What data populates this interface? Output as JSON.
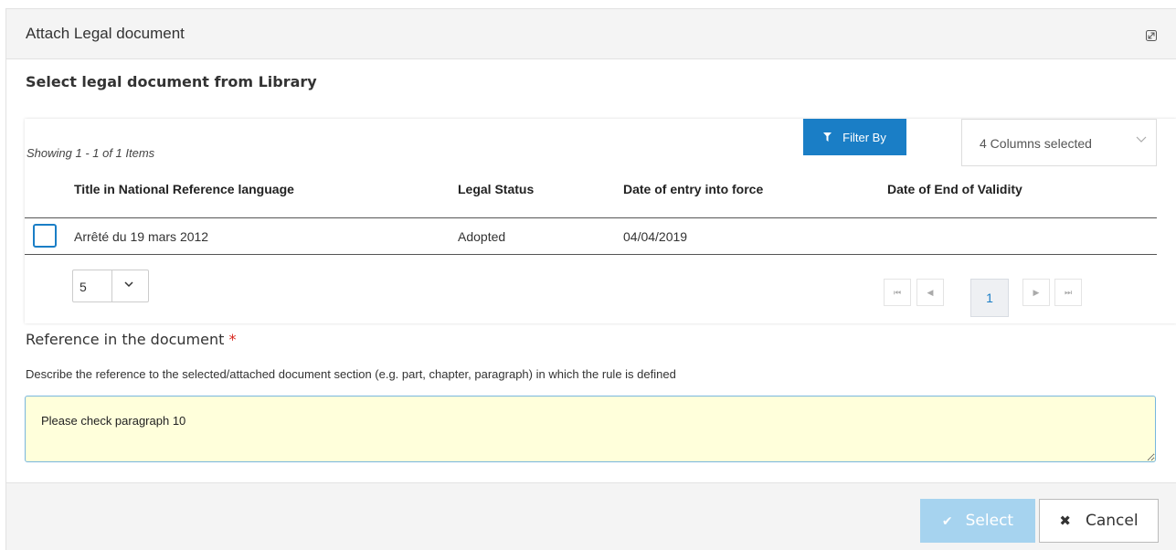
{
  "dialog": {
    "title": "Attach Legal document",
    "resize_icon": "expand-icon"
  },
  "library": {
    "section_title": "Select legal document from Library",
    "showing_text": "Showing 1 - 1 of 1 Items",
    "filter_label": "Filter By",
    "columns_selected": "4 Columns selected",
    "headers": [
      "Title in National Reference language",
      "Legal Status",
      "Date of entry into force",
      "Date of End of Validity"
    ],
    "rows": [
      {
        "checked": false,
        "title": "Arrêté du 19 mars 2012",
        "status": "Adopted",
        "entry_date": "04/04/2019",
        "end_date": ""
      }
    ],
    "page_size": "5",
    "current_page": "1"
  },
  "reference": {
    "title": "Reference in the document",
    "required_mark": "*",
    "description": "Describe the reference to the selected/attached document section (e.g. part, chapter, paragraph) in which the rule is defined",
    "value": "Please check paragraph 10"
  },
  "footer": {
    "select_label": "Select",
    "cancel_label": "Cancel"
  },
  "colors": {
    "accent": "#1a7ec6",
    "select_disabled": "#a6d3ef",
    "textarea_bg": "#ffffdb",
    "required": "#d9261c"
  }
}
